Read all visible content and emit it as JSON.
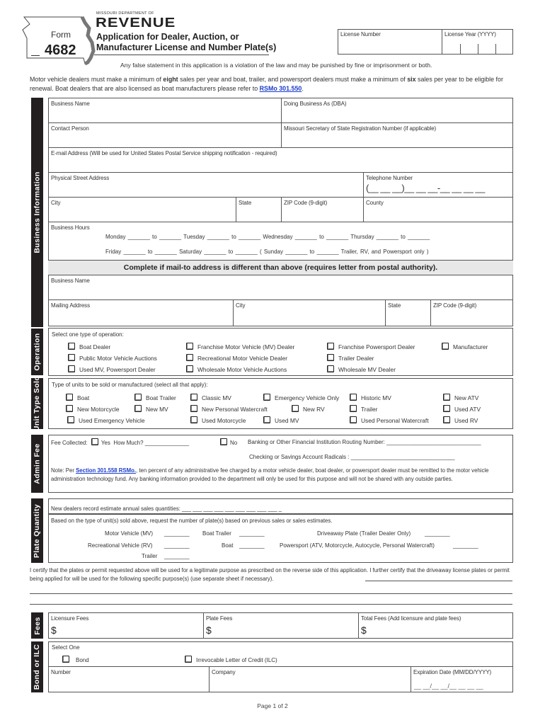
{
  "header": {
    "form_label": "Form",
    "form_number": "4682",
    "dept_top": "MISSOURI DEPARTMENT OF",
    "dept_name": "REVENUE",
    "title_line1": "Application for Dealer, Auction, or",
    "title_line2": "Manufacturer License and Number Plate(s)",
    "license_number_label": "License Number",
    "license_year_label": "License Year (YYYY)",
    "warning": "Any false statement in this application is a violation of the law and may be punished by fine or imprisonment or both."
  },
  "intro": {
    "part1": "Motor vehicle dealers must make a minimum of ",
    "bold1": "eight",
    "part2": " sales per year and boat, trailer, and powersport dealers must make a minimum of ",
    "bold2": "six",
    "part3": " sales per year to be eligible for renewal. Boat dealers that are also licensed as boat manufacturers please refer to ",
    "link": "RSMo 301.550",
    "part4": "."
  },
  "business": {
    "section_label": "Business Information",
    "business_name": "Business Name",
    "dba": "Doing Business As (DBA)",
    "contact_person": "Contact Person",
    "sos_number": "Missouri Secretary of State Registration Number (if applicable)",
    "email": "E-mail Address (Will be used for United States Postal Service shipping notification - required)",
    "street": "Physical Street Address",
    "phone": "Telephone Number",
    "phone_mask": "(__ __ __)__ __ __-__ __ __ __",
    "city": "City",
    "state": "State",
    "zip": "ZIP Code (9-digit)",
    "county": "County",
    "hours_label": "Business Hours",
    "hours_row1": "Monday _______ to _______   Tuesday _______ to _______   Wednesday _______ to _______   Thursday _______ to _______",
    "hours_row2": "Friday _______ to _______   Saturday _______ to _______   ( Sunday _______ to _______ Trailer, RV, and Powersport only )",
    "mailto_header": "Complete if mail-to address is different than above (requires letter from postal authority).",
    "mail_business_name": "Business Name",
    "mailing_address": "Mailing Address",
    "mail_city": "City",
    "mail_state": "State",
    "mail_zip": "ZIP Code (9-digit)"
  },
  "operation": {
    "section_label": "Operation",
    "prompt": "Select one type of operation:",
    "options": [
      "Boat Dealer",
      "Public Motor Vehicle Auctions",
      "Used MV, Powersport Dealer",
      "Franchise Motor Vehicle (MV) Dealer",
      "Recreational Motor Vehicle Dealer",
      "Wholesale Motor Vehicle Auctions",
      "Franchise Powersport Dealer",
      "Trailer Dealer",
      "Wholesale MV Dealer",
      "Manufacturer"
    ]
  },
  "units": {
    "section_label": "Unit Type Sold",
    "prompt": "Type of units to be sold or manufactured (select all that apply):",
    "options": [
      "Boat",
      "Boat Trailer",
      "Classic MV",
      "Emergency Vehicle Only",
      "Historic MV",
      "New ATV",
      "New Motorcycle",
      "New MV",
      "New Personal Watercraft",
      "New RV",
      "Trailer",
      "Used ATV",
      "Used Emergency Vehicle",
      "Used Motorcycle",
      "Used MV",
      "Used Personal Watercraft",
      "Used RV"
    ]
  },
  "admin_fee": {
    "section_label": "Admin Fee",
    "fee_collected": "Fee Collected:",
    "yes": "Yes",
    "how_much": "How Much? ______________",
    "no": "No",
    "routing": "Banking or Other Financial Institution Routing Number: ______________________________",
    "radicals": "Checking or Savings Account Radicals : _________________________________",
    "note_prefix": "Note: Per ",
    "note_link": "Section 301.558 RSMo.",
    "note_text": ", ten percent of any administrative fee charged by a motor vehicle dealer, boat dealer, or powersport dealer must be remitted to the motor vehicle administration technology fund. Any banking information provided to the department will only be used for this purpose and will not be shared with any outside parties."
  },
  "plate_quantity": {
    "section_label": "Plate Quantity",
    "new_dealers": "New dealers record estimate annual sales quantities: ___ ___ ___ ___ ___ ___ ___ ___ ___ _",
    "based_on": "Based on the type of unit(s) sold above, request the number of plate(s) based on previous sales or sales estimates.",
    "mv": "Motor Vehicle (MV)",
    "rv": "Recreational Vehicle (RV)",
    "trailer": "Trailer",
    "boat_trailer": "Boat Trailer",
    "boat": "Boat",
    "driveaway": "Driveaway Plate (Trailer Dealer Only)",
    "powersport": "Powersport (ATV, Motorcycle, Autocycle, Personal Watercraft)",
    "blank": "________"
  },
  "certify": {
    "text": "I certify that the plates or permit requested above will be used for a legitimate purpose as prescribed on the reverse side of this application. I further certify that the driveaway license plates or permit being applied for will be used for the following specific purpose(s) (use separate sheet if necessary)."
  },
  "fees": {
    "section_label": "Fees",
    "licensure": "Licensure Fees",
    "plate": "Plate Fees",
    "total": "Total Fees (Add licensure and plate fees)",
    "dollar": "$"
  },
  "bond": {
    "section_label": "Bond or ILC",
    "select_one": "Select One",
    "bond": "Bond",
    "ilc": "Irrevocable Letter of Credit (ILC)",
    "number": "Number",
    "company": "Company",
    "expiration": "Expiration Date (MM/DD/YYYY)",
    "date_mask": "__ __/__ __/__ __ __ __"
  },
  "footer": {
    "page": "Page 1 of 2"
  }
}
